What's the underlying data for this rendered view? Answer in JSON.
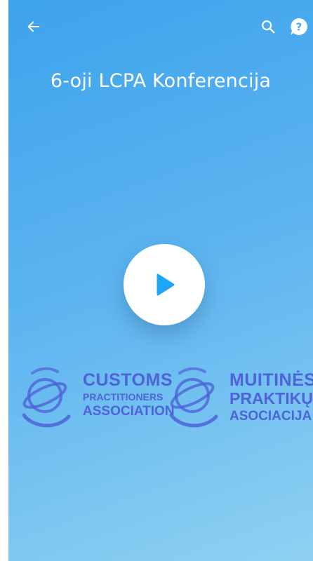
{
  "header": {
    "back_icon": "arrow-left-icon",
    "search_icon": "search-icon",
    "help_icon": "question-bubble-icon"
  },
  "page": {
    "title": "6-oji LCPA Konferencija"
  },
  "player": {
    "play_icon": "play-icon"
  },
  "logos": {
    "english": {
      "line1": "CUSTOMS",
      "line2": "PRACTITIONERS",
      "line3": "ASSOCIATION"
    },
    "lithuanian": {
      "line1": "MUITINĖS",
      "line2": "PRAKTIKŲ",
      "line3": "ASOCIACIJA"
    }
  },
  "colors": {
    "gradient_start": "#3da3ec",
    "gradient_end": "#8fd1f2",
    "play_accent": "#1ea6f5",
    "logo_blue": "#4e63d8"
  }
}
